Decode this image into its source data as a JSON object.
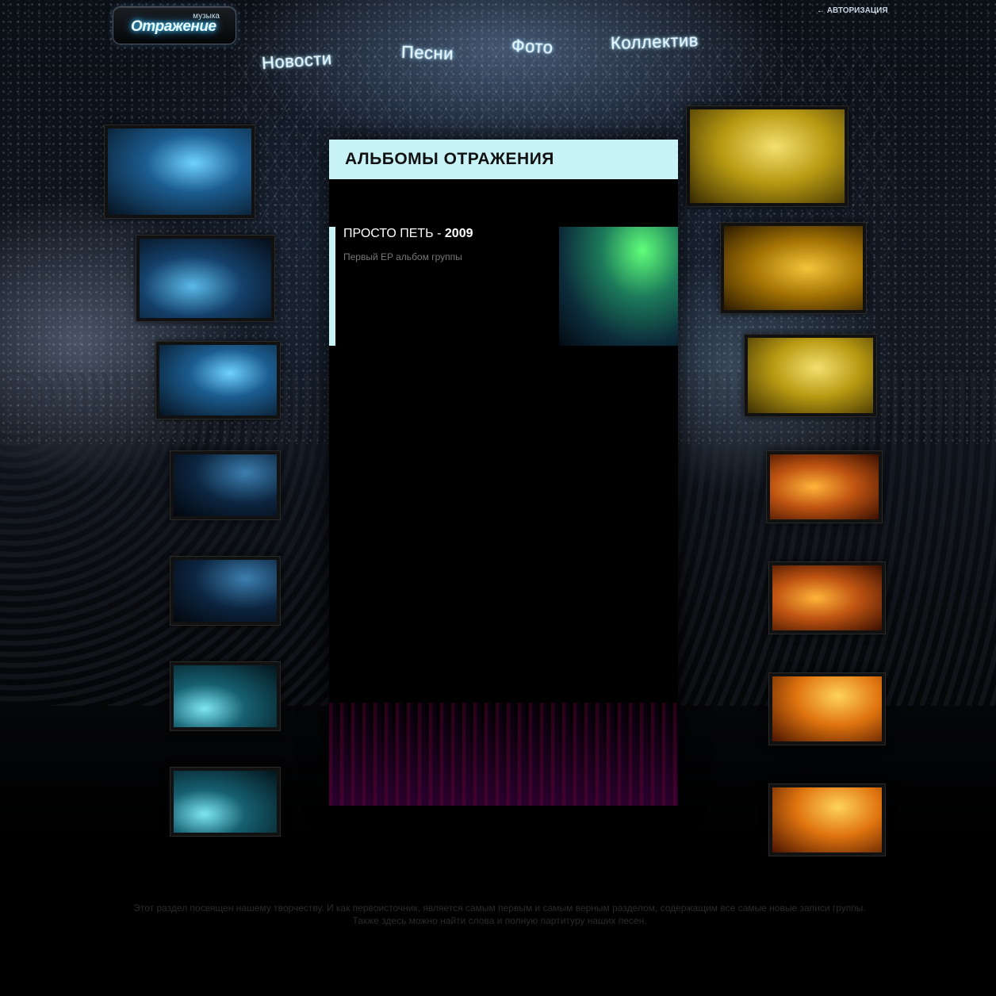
{
  "header": {
    "logo_small": "музыка",
    "logo_main": "Отражение",
    "auth_link": "← АВТОРИЗАЦИЯ"
  },
  "nav": [
    {
      "label": "Новости"
    },
    {
      "label": "Песни"
    },
    {
      "label": "Фото"
    },
    {
      "label": "Коллектив"
    }
  ],
  "main": {
    "title": "АЛЬБОМЫ ОТРАЖЕНИЯ",
    "album": {
      "name": "ПРОСТО ПЕТЬ",
      "separator": " - ",
      "year": "2009",
      "description": "Первый EP альбом группы"
    }
  },
  "footer": {
    "line1": "Этот раздел посвящен нашему творчеству. И как первоисточник, является самым первым и самым верным разделом, содержащим все самые новые записи группы.",
    "line2": "Также здесь можно найти слова и полную партитуру наших песен."
  }
}
